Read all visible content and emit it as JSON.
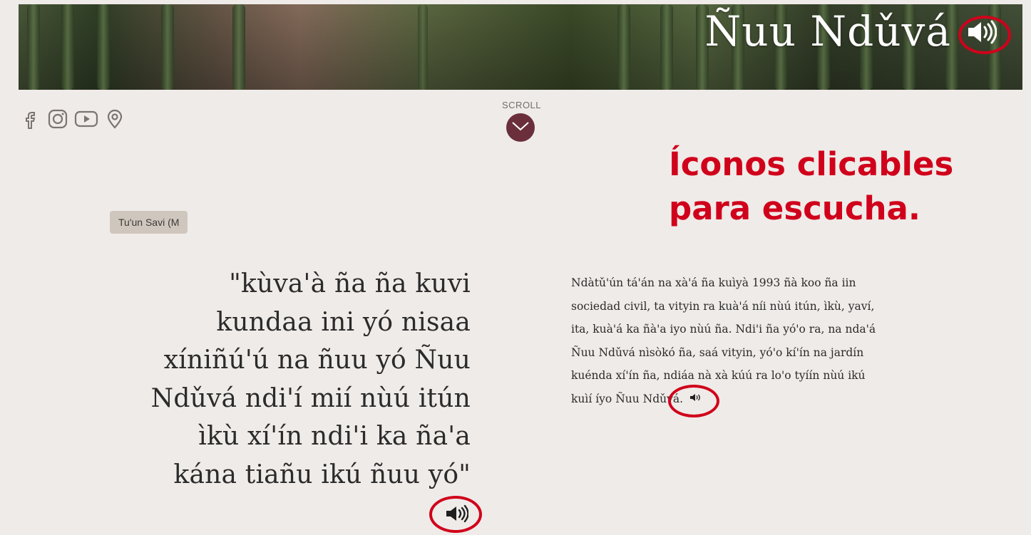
{
  "hero": {
    "title": "Ñuu Ndǔvá",
    "audio_icon": "speaker-icon"
  },
  "social": {
    "icons": [
      "facebook-icon",
      "instagram-icon",
      "youtube-icon",
      "location-pin-icon"
    ]
  },
  "scroll": {
    "label": "SCROLL",
    "icon": "chevron-down-icon",
    "color": "#6a2f3b"
  },
  "annotation": {
    "line1": "Íconos clicables",
    "line2": "para escucha."
  },
  "tag": {
    "label": "Tu'un Savi (M"
  },
  "quote": {
    "lines": [
      "\"kùva'à ña ña kuvi",
      "kundaa ini yó nisaa",
      "xíniñú'ú na ñuu yó Ñuu",
      "Ndǔvá ndi'í mií nùú itún",
      "ìkù xí'ín ndi'i ka ña'a",
      "kána tiañu ikú ñuu yó\""
    ]
  },
  "paragraph": {
    "text": "Ndàtǔ'ún tá'án na xà'á ña kuìyà 1993 ñà koo ña iin sociedad civil, ta vityin ra kuà'á níi nùú itún, ìkù, yaví, ita, kuà'á ka ñà'a iyo nùú ña. Ndi'i ña yó'o ra, na nda'á Ñuu Ndǔvá nìsòkó ña, saá vityin, yó'o kí'ín na jardín kuénda xí'ín ña, ndiáa nà xà kúú ra lo'o tyíín nùú ikú kuìí íyo Ñuu Ndǔvá."
  },
  "colors": {
    "accent": "#d0021b",
    "background": "#efebe8",
    "tag_bg": "#cfc6bd"
  }
}
